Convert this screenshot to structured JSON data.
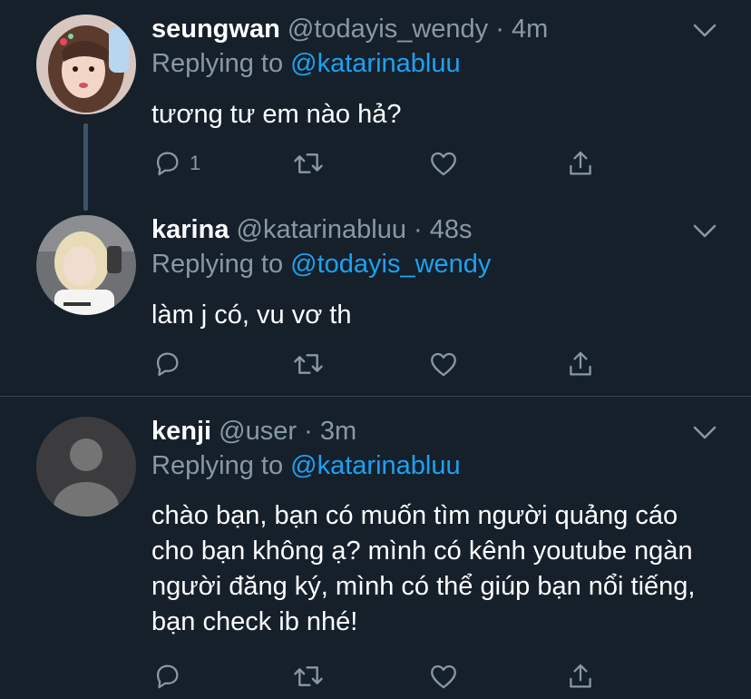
{
  "tweets": [
    {
      "name": "seungwan",
      "handle": "@todayis_wendy",
      "dot": "·",
      "time": "4m",
      "replying_prefix": "Replying to ",
      "replying_mention": "@katarinabluu",
      "text": "tương tư em nào hả?",
      "reply_count": "1"
    },
    {
      "name": "karina",
      "handle": "@katarinabluu",
      "dot": "·",
      "time": "48s",
      "replying_prefix": "Replying to ",
      "replying_mention": "@todayis_wendy",
      "text": "làm j có, vu vơ th",
      "reply_count": ""
    },
    {
      "name": "kenji",
      "handle": "@user",
      "dot": "·",
      "time": "3m",
      "replying_prefix": "Replying to ",
      "replying_mention": "@katarinabluu",
      "text": "chào bạn, bạn có muốn tìm người quảng cáo cho bạn không ạ? mình có kênh youtube ngàn người đăng ký, mình có thể giúp bạn nổi tiếng, bạn check ib nhé!",
      "reply_count": ""
    }
  ],
  "colors": {
    "background": "#15202b",
    "muted": "#8899a6",
    "link": "#1da1f2",
    "divider": "#38444d"
  },
  "icons": [
    "reply-icon",
    "retweet-icon",
    "like-icon",
    "share-icon",
    "chevron-down-icon"
  ]
}
